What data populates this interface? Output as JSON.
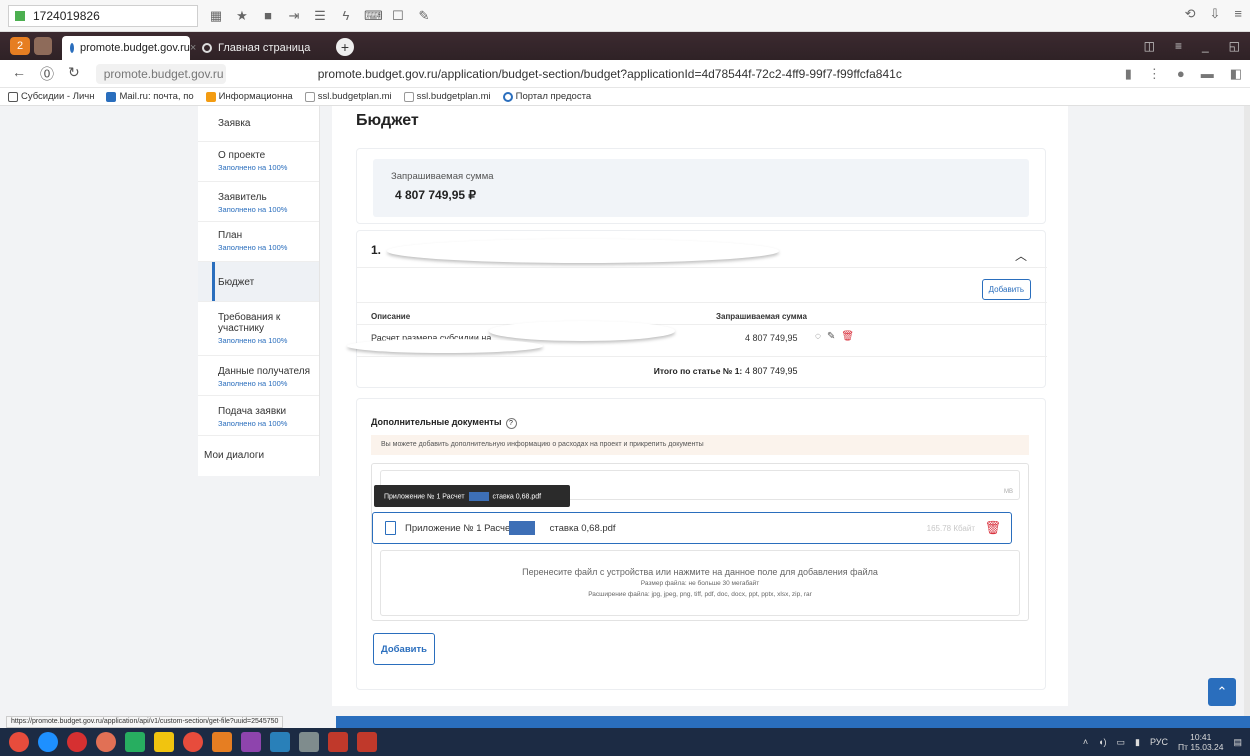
{
  "topbar": {
    "counter": "1724019826"
  },
  "tabs": [
    {
      "label": "promote.budget.gov.ru",
      "close": "×"
    },
    {
      "label": "Главная страница"
    }
  ],
  "tab_badge": "2",
  "address": {
    "host": "promote.budget.gov.ru",
    "url": "promote.budget.gov.ru/application/budget-section/budget?applicationId=4d78544f-72c2-4ff9-99f7-f99ffcfa841c"
  },
  "bookmarks": [
    "Субсидии - Личн",
    "Mail.ru: почта, по",
    "Информационна",
    "ssl.budgetplan.mi",
    "ssl.budgetplan.mi",
    "Портал предоста"
  ],
  "sidebar": {
    "head": "Заявка",
    "items": [
      {
        "label": "О проекте",
        "status": "Заполнено на 100%"
      },
      {
        "label": "Заявитель",
        "status": "Заполнено на 100%"
      },
      {
        "label": "План",
        "status": "Заполнено на 100%"
      },
      {
        "label": "Бюджет",
        "status": ""
      },
      {
        "label": "Требования к участнику",
        "status": "Заполнено на 100%"
      },
      {
        "label": "Данные получателя",
        "status": "Заполнено на 100%"
      },
      {
        "label": "Подача заявки",
        "status": "Заполнено на 100%"
      }
    ],
    "dialogs": "Мои диалоги"
  },
  "main": {
    "title": "Бюджет",
    "requested": {
      "label": "Запрашиваемая сумма",
      "value": "4 807 749,95 ₽"
    },
    "section": {
      "number": "1.",
      "add_button": "Добавить",
      "col_description": "Описание",
      "col_amount": "Запрашиваемая сумма",
      "row_description": "Расчет размера субсидии на",
      "row_amount": "4 807 749,95",
      "total_label": "Итого по статье № 1:",
      "total_value": "4 807 749,95"
    },
    "docs": {
      "title": "Дополнительные документы",
      "notice": "Вы можете добавить дополнительную информацию о расходах на проект и прикрепить документы",
      "tooltip": "Приложение № 1 Расчет",
      "tooltip_tail": "ставка 0,68.pdf",
      "mb": "MB",
      "file_name": "Приложение № 1 Расчет",
      "file_name_tail": "ставка 0,68.pdf",
      "file_size": "165.78 Кбайт",
      "drop_line1": "Перенесите файл с устройства или нажмите на данное поле для добавления файла",
      "drop_line2": "Размер файла: не больше 30 мегабайт",
      "drop_line3": "Расширение файла: jpg, jpeg, png, tiff, pdf, doc, docx, ppt, pptx, xlsx, zip, rar",
      "add_button": "Добавить"
    }
  },
  "status_url": "https://promote.budget.gov.ru/application/api/v1/custom-section/get-file?uuid=2545750",
  "taskbar": {
    "lang": "РУС",
    "time": "10:41",
    "date": "Пт 15.03.24"
  },
  "colors": {
    "accent": "#2a6ebd",
    "danger": "#d9333f",
    "sum_bg": "#f1f4f8",
    "notice_bg": "#fbf3ec"
  }
}
